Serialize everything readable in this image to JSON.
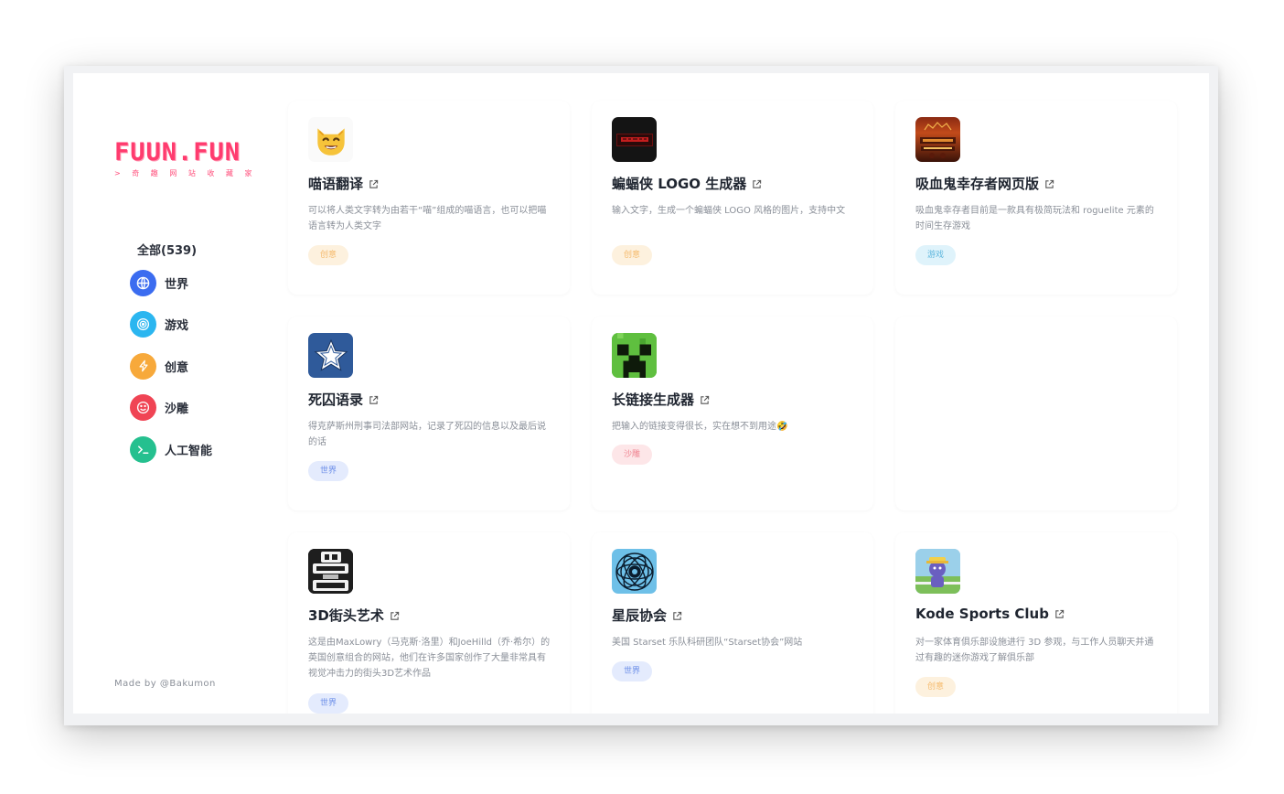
{
  "logo": {
    "text": "FUUN.FUN",
    "subtitle": "> 奇 趣 网 站 收 藏 家"
  },
  "sidebar": {
    "all_label": "全部(539)",
    "categories": [
      {
        "label": "世界",
        "icon": "globe-icon",
        "color": "#3b6cf0"
      },
      {
        "label": "游戏",
        "icon": "target-icon",
        "color": "#2bb6f0"
      },
      {
        "label": "创意",
        "icon": "bolt-icon",
        "color": "#f7a93b"
      },
      {
        "label": "沙雕",
        "icon": "smile-icon",
        "color": "#f04454"
      },
      {
        "label": "人工智能",
        "icon": "terminal-icon",
        "color": "#25c08f"
      }
    ],
    "made_by": "Made by @Bakumon"
  },
  "cards": [
    {
      "title": "喵语翻译",
      "desc": "可以将人类文字转为由若干“喵”组成的喵语言，也可以把喵语言转为人类文字",
      "tag": "创意",
      "icon": "cat-face-icon"
    },
    {
      "title": "蝙蝠侠 LOGO 生成器",
      "desc": "输入文字，生成一个蝙蝠侠 LOGO 风格的图片，支持中文",
      "tag": "创意",
      "icon": "batman-logo-icon"
    },
    {
      "title": "吸血鬼幸存者网页版",
      "desc": "吸血鬼幸存者目前是一款具有极简玩法和 roguelite 元素的时间生存游戏",
      "tag": "游戏",
      "icon": "vampire-survivors-icon"
    },
    {
      "title": "死囚语录",
      "desc": "得克萨斯州刑事司法部网站，记录了死囚的信息以及最后说的话",
      "tag": "世界",
      "icon": "texas-star-icon"
    },
    {
      "title": "长链接生成器",
      "desc": "把输入的链接变得很长，实在想不到用途🤣",
      "tag": "沙雕",
      "icon": "creeper-icon"
    },
    {
      "title": "3D街头艺术",
      "desc": "这是由MaxLowry（马克斯·洛里）和JoeHilld（乔·希尔）的英国创意组合的网站，他们在许多国家创作了大量非常具有视觉冲击力的街头3D艺术作品",
      "tag": "世界",
      "icon": "3d-joe-max-icon"
    },
    {
      "title": "星辰协会",
      "desc": "美国 Starset 乐队科研团队“Starset协会”网站",
      "tag": "世界",
      "icon": "starset-icon"
    },
    {
      "title": "Kode Sports Club",
      "desc": "对一家体育俱乐部设施进行 3D 参观，与工作人员聊天并通过有趣的迷你游戏了解俱乐部",
      "tag": "创意",
      "icon": "kode-club-icon"
    }
  ]
}
